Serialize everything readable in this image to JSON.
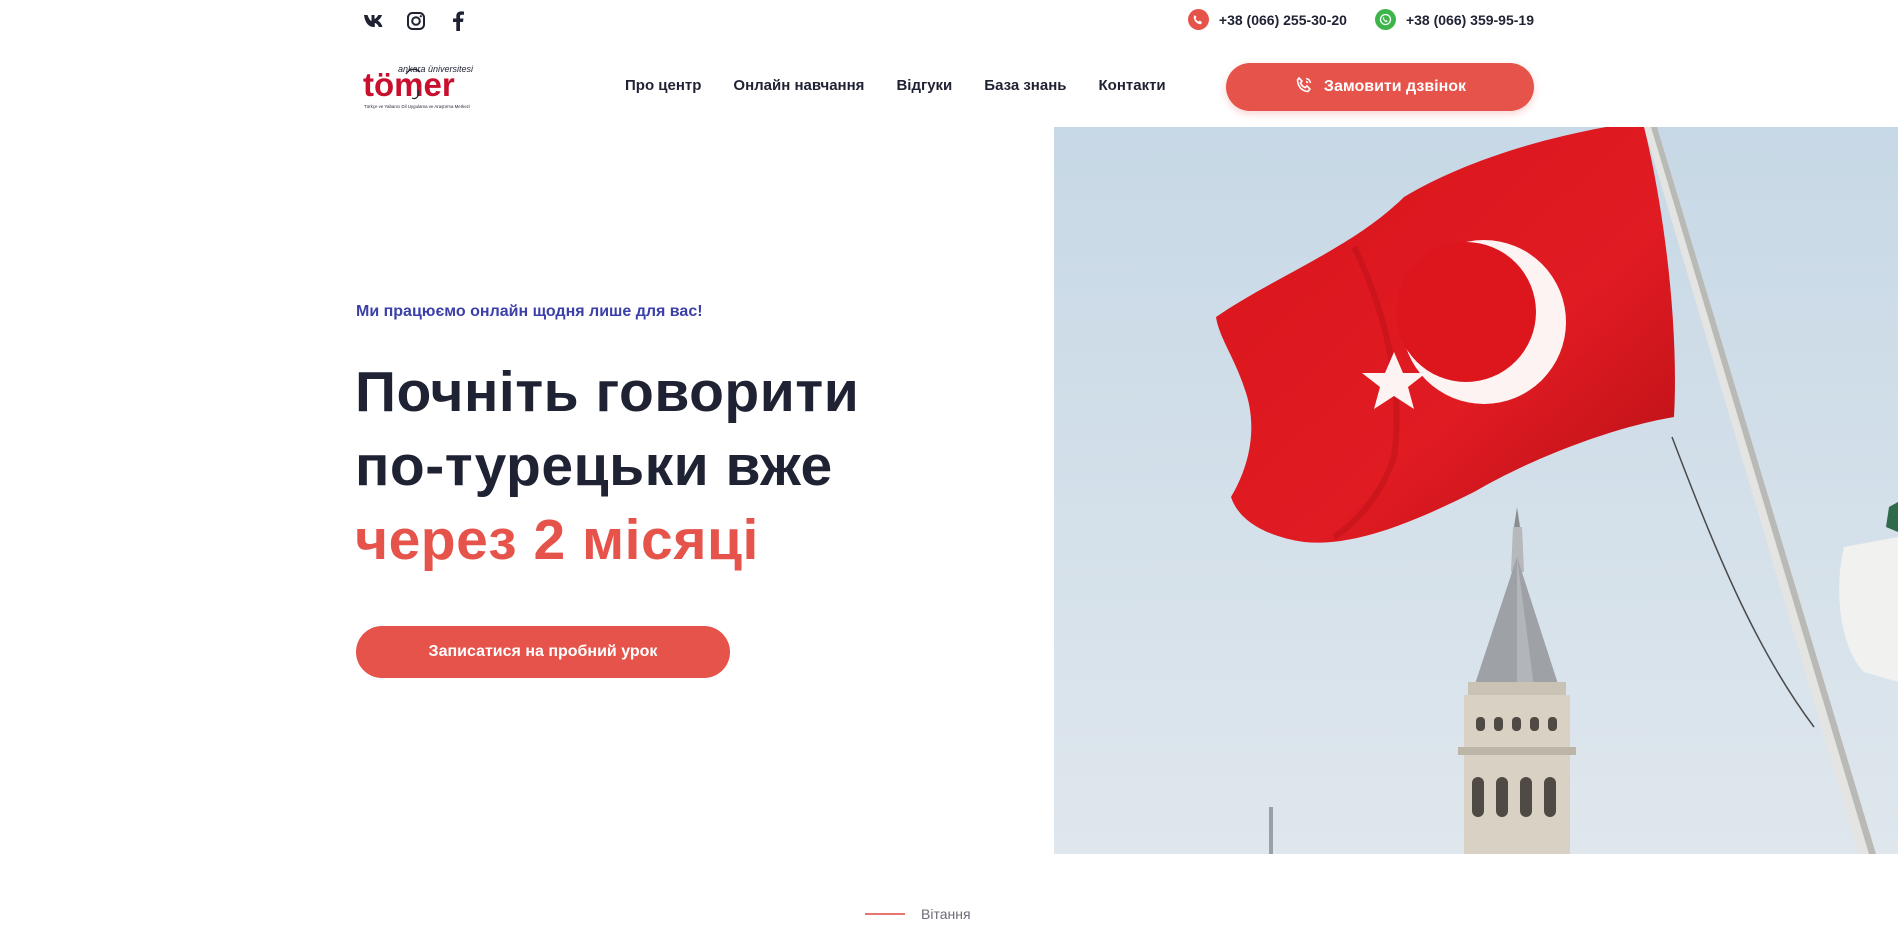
{
  "social": {
    "icons": [
      "vk-icon",
      "instagram-icon",
      "facebook-icon"
    ]
  },
  "contacts": {
    "phone1": "+38 (066) 255-30-20",
    "phone2": "+38 (066) 359-95-19",
    "phone1_icon": "phone-icon",
    "phone2_icon": "whatsapp-icon"
  },
  "logo": {
    "name": "tömer",
    "subtitle": "ankara üniversitesi",
    "caption": "Türkçe ve Yabancı Dil Uygulama ve Araştırma Merkezi"
  },
  "nav": {
    "items": [
      "Про центр",
      "Онлайн навчання",
      "Відгуки",
      "База знань",
      "Контакти"
    ]
  },
  "header": {
    "call_button": "Замовити дзвінок"
  },
  "hero": {
    "tagline": "Ми працюємо онлайн щодня лише для вас!",
    "line1": "Почніть говорити",
    "line2": "по-турецьки вже",
    "line3_accent": "через 2 місяці",
    "cta": "Записатися на пробний урок"
  },
  "section": {
    "label": "Вітання"
  },
  "colors": {
    "accent": "#e5534b",
    "dark": "#1f2233",
    "tagline": "#3b3fa8",
    "whatsapp": "#3db54a"
  }
}
